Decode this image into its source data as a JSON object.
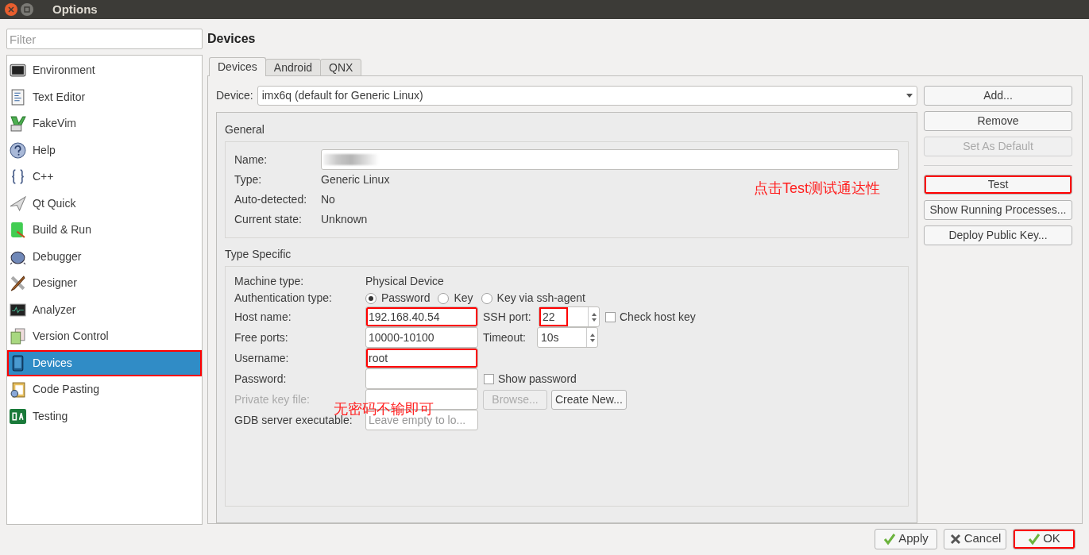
{
  "window": {
    "title": "Options"
  },
  "filter": {
    "placeholder": "Filter"
  },
  "categories": [
    {
      "label": "Environment",
      "selected": false,
      "highlighted": false
    },
    {
      "label": "Text Editor",
      "selected": false,
      "highlighted": false
    },
    {
      "label": "FakeVim",
      "selected": false,
      "highlighted": false
    },
    {
      "label": "Help",
      "selected": false,
      "highlighted": false
    },
    {
      "label": "C++",
      "selected": false,
      "highlighted": false
    },
    {
      "label": "Qt Quick",
      "selected": false,
      "highlighted": false
    },
    {
      "label": "Build & Run",
      "selected": false,
      "highlighted": false
    },
    {
      "label": "Debugger",
      "selected": false,
      "highlighted": false
    },
    {
      "label": "Designer",
      "selected": false,
      "highlighted": false
    },
    {
      "label": "Analyzer",
      "selected": false,
      "highlighted": false
    },
    {
      "label": "Version Control",
      "selected": false,
      "highlighted": false
    },
    {
      "label": "Devices",
      "selected": true,
      "highlighted": true
    },
    {
      "label": "Code Pasting",
      "selected": false,
      "highlighted": false
    },
    {
      "label": "Testing",
      "selected": false,
      "highlighted": false
    }
  ],
  "page_title": "Devices",
  "tabs": [
    {
      "label": "Devices",
      "selected": true
    },
    {
      "label": "Android",
      "selected": false
    },
    {
      "label": "QNX",
      "selected": false
    }
  ],
  "device": {
    "label": "Device:",
    "value": "imx6q (default for Generic Linux)"
  },
  "general": {
    "title": "General",
    "name_label": "Name:",
    "name_redacted": true,
    "rows": [
      {
        "label": "Type:",
        "value": "Generic Linux"
      },
      {
        "label": "Auto-detected:",
        "value": "No"
      },
      {
        "label": "Current state:",
        "value": "Unknown"
      }
    ]
  },
  "type_specific": {
    "title": "Type Specific",
    "machine_type": {
      "label": "Machine type:",
      "value": "Physical Device"
    },
    "auth": {
      "label": "Authentication type:",
      "options": [
        {
          "label": "Password",
          "selected": true
        },
        {
          "label": "Key",
          "selected": false
        },
        {
          "label": "Key via ssh-agent",
          "selected": false
        }
      ]
    },
    "host": {
      "label": "Host name:",
      "value": "192.168.40.54",
      "highlighted": true
    },
    "ssh_port": {
      "label": "SSH port:",
      "value": "22",
      "highlighted": true
    },
    "check_host_key": {
      "label": "Check host key",
      "checked": false
    },
    "free_ports": {
      "label": "Free ports:",
      "value": "10000-10100"
    },
    "timeout": {
      "label": "Timeout:",
      "value": "10s"
    },
    "username": {
      "label": "Username:",
      "value": "root",
      "highlighted": true
    },
    "password": {
      "label": "Password:"
    },
    "show_password": {
      "label": "Show password",
      "checked": false
    },
    "key_file": {
      "label": "Private key file:",
      "disabled": true,
      "browse": "Browse...",
      "create": "Create New..."
    },
    "gdb": {
      "label": "GDB server executable:",
      "placeholder": "Leave empty to lo..."
    }
  },
  "side_buttons": [
    {
      "label": "Add...",
      "disabled": false,
      "highlighted": false
    },
    {
      "label": "Remove",
      "disabled": false,
      "highlighted": false
    },
    {
      "label": "Set As Default",
      "disabled": true,
      "highlighted": false
    },
    {
      "label": "Test",
      "disabled": false,
      "highlighted": true
    },
    {
      "label": "Show Running Processes...",
      "disabled": false,
      "highlighted": false
    },
    {
      "label": "Deploy Public Key...",
      "disabled": false,
      "highlighted": false
    }
  ],
  "annotations": [
    "点击Test测试通达性",
    "无密码不输即可"
  ],
  "footer_buttons": [
    {
      "label": "Apply",
      "highlighted": false
    },
    {
      "label": "Cancel",
      "highlighted": false
    },
    {
      "label": "OK",
      "highlighted": true
    }
  ]
}
